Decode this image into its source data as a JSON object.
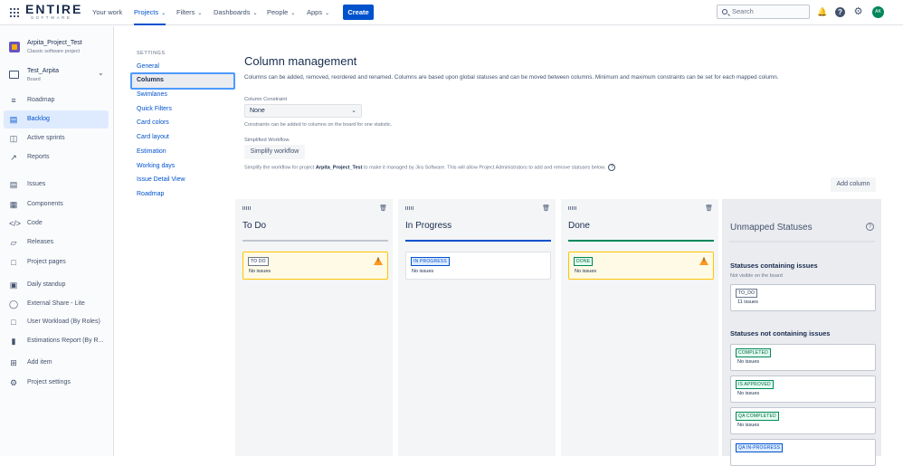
{
  "topnav": {
    "logo_text": "ENTIRE",
    "logo_sub": "SOFTWARE",
    "items": [
      {
        "label": "Your work",
        "chevron": false,
        "active": false
      },
      {
        "label": "Projects",
        "chevron": true,
        "active": true
      },
      {
        "label": "Filters",
        "chevron": true,
        "active": false
      },
      {
        "label": "Dashboards",
        "chevron": true,
        "active": false
      },
      {
        "label": "People",
        "chevron": true,
        "active": false
      },
      {
        "label": "Apps",
        "chevron": true,
        "active": false
      }
    ],
    "create_label": "Create",
    "search_placeholder": "Search",
    "avatar_initials": "AK",
    "accent_color": "#0052cc"
  },
  "sidebar": {
    "project_name": "Arpita_Project_Test",
    "project_type": "Classic software project",
    "board_name": "Test_Arpita",
    "board_type": "Board",
    "items": [
      {
        "label": "Roadmap",
        "icon": "roadmap-icon"
      },
      {
        "label": "Backlog",
        "icon": "backlog-icon"
      },
      {
        "label": "Active sprints",
        "icon": "sprints-icon"
      },
      {
        "label": "Reports",
        "icon": "reports-icon"
      },
      {
        "label": "Issues",
        "icon": "issues-icon"
      },
      {
        "label": "Components",
        "icon": "components-icon"
      },
      {
        "label": "Code",
        "icon": "code-icon"
      },
      {
        "label": "Releases",
        "icon": "releases-icon"
      },
      {
        "label": "Project pages",
        "icon": "pages-icon"
      },
      {
        "label": "Daily standup",
        "icon": "calendar-icon"
      },
      {
        "label": "External Share - Lite",
        "icon": "share-icon"
      },
      {
        "label": "User Workload (By Roles)",
        "icon": "workload-icon"
      },
      {
        "label": "Estimations Report (By R...",
        "icon": "estimation-icon"
      },
      {
        "label": "Add item",
        "icon": "add-item-icon"
      },
      {
        "label": "Project settings",
        "icon": "gear-icon"
      }
    ],
    "active_index": 1
  },
  "settings_nav": {
    "heading": "SETTINGS",
    "items": [
      "General",
      "Columns",
      "Swimlanes",
      "Quick Filters",
      "Card colors",
      "Card layout",
      "Estimation",
      "Working days",
      "Issue Detail View",
      "Roadmap"
    ],
    "active": "Columns"
  },
  "main": {
    "title": "Column management",
    "description": "Columns can be added, removed, reordered and renamed. Columns are based upon global statuses and can be moved between columns. Minimum and maximum constraints can be set for each mapped column.",
    "constraint_label": "Column Constraint",
    "constraint_value": "None",
    "constraint_help": "Constraints can be added to columns on the board for one statistic.",
    "workflow_label": "Simplified Workflow",
    "workflow_button": "Simplify workflow",
    "workflow_help_pre": "Simplify the workflow for project ",
    "workflow_help_project": "Arpita_Project_Test",
    "workflow_help_post": " to make it managed by Jira Software. This will allow Project Administrators to add and remove statuses below.",
    "add_column_label": "Add column"
  },
  "columns": [
    {
      "title": "To Do",
      "bar_color": "#c1c7d0",
      "status": "TO DO",
      "status_style": "gray",
      "issues": "No issues",
      "warning": true
    },
    {
      "title": "In Progress",
      "bar_color": "#0052cc",
      "status": "IN PROGRESS",
      "status_style": "blue",
      "issues": "No issues",
      "warning": false
    },
    {
      "title": "Done",
      "bar_color": "#00875a",
      "status": "DONE",
      "status_style": "green",
      "issues": "No issues",
      "warning": true
    }
  ],
  "unmapped": {
    "title": "Unmapped Statuses",
    "containing_title": "Statuses containing issues",
    "containing_sub": "Not visible on the board",
    "containing": [
      {
        "status": "TO_DO",
        "count": "11 issues",
        "style": "gray"
      }
    ],
    "not_containing_title": "Statuses not containing issues",
    "not_containing": [
      {
        "status": "COMPLETED",
        "count": "No issues",
        "style": "green"
      },
      {
        "status": "IS APPROVED",
        "count": "No issues",
        "style": "green"
      },
      {
        "status": "QA COMPLETED",
        "count": "No issues",
        "style": "green"
      },
      {
        "status": "QA IN-PROGRESS",
        "count": "",
        "style": "blue"
      }
    ]
  }
}
